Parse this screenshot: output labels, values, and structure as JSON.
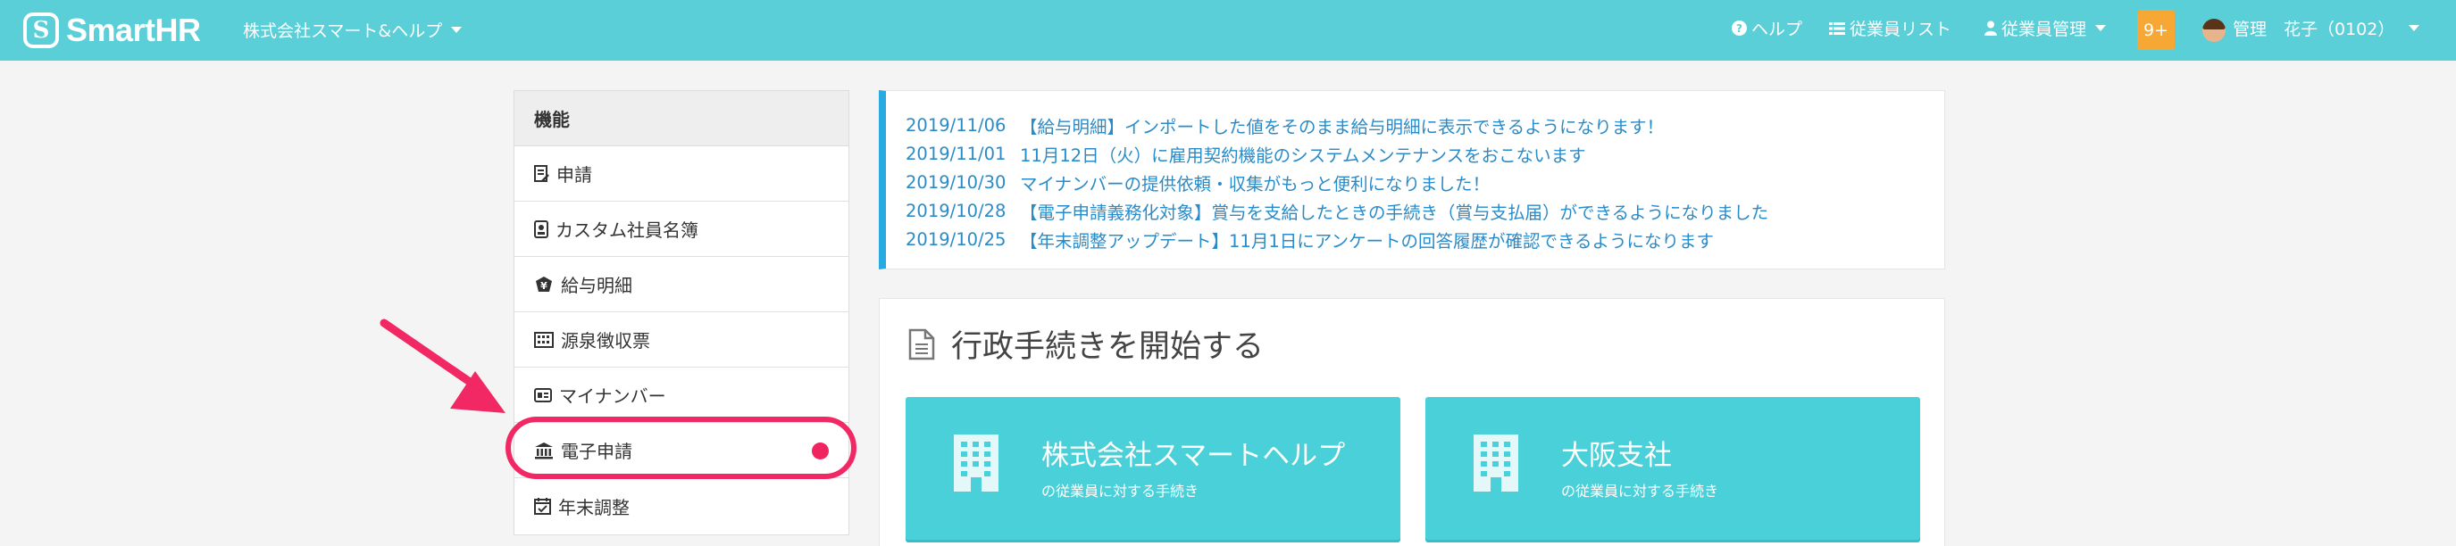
{
  "header": {
    "logo_mark": "S",
    "logo_text": "SmartHR",
    "company": "株式会社スマート&ヘルプ",
    "help": "ヘルプ",
    "employee_list": "従業員リスト",
    "employee_manage": "従業員管理",
    "notifications": "9+",
    "user": "管理　花子（0102）"
  },
  "sidebar": {
    "heading": "機能",
    "items": [
      {
        "label": "申請",
        "icon": "form-icon"
      },
      {
        "label": "カスタム社員名簿",
        "icon": "id-badge-icon"
      },
      {
        "label": "給与明細",
        "icon": "yen-icon"
      },
      {
        "label": "源泉徴収票",
        "icon": "calculator-icon"
      },
      {
        "label": "マイナンバー",
        "icon": "id-card-icon"
      },
      {
        "label": "電子申請",
        "icon": "bank-icon",
        "highlighted": true
      },
      {
        "label": "年末調整",
        "icon": "calendar-check-icon"
      }
    ]
  },
  "news": [
    {
      "date": "2019/11/06",
      "text": "【給与明細】インポートした値をそのまま給与明細に表示できるようになります！"
    },
    {
      "date": "2019/11/01",
      "text": "11月12日（火）に雇用契約機能のシステムメンテナンスをおこないます"
    },
    {
      "date": "2019/10/30",
      "text": "マイナンバーの提供依頼・収集がもっと便利になりました！"
    },
    {
      "date": "2019/10/28",
      "text": "【電子申請義務化対象】賞与を支給したときの手続き（賞与支払届）ができるようになりました"
    },
    {
      "date": "2019/10/25",
      "text": "【年末調整アップデート】11月1日にアンケートの回答履歴が確認できるようになります"
    }
  ],
  "procedures": {
    "title": "行政手続きを開始する",
    "cards": [
      {
        "name": "株式会社スマートヘルプ",
        "sub": "の従業員に対する手続き"
      },
      {
        "name": "大阪支社",
        "sub": "の従業員に対する手続き"
      }
    ]
  },
  "colors": {
    "header": "#5acfd8",
    "card": "#49d0d8",
    "news_accent": "#29abe2",
    "highlight": "#f22864",
    "badge": "#f7a733"
  }
}
